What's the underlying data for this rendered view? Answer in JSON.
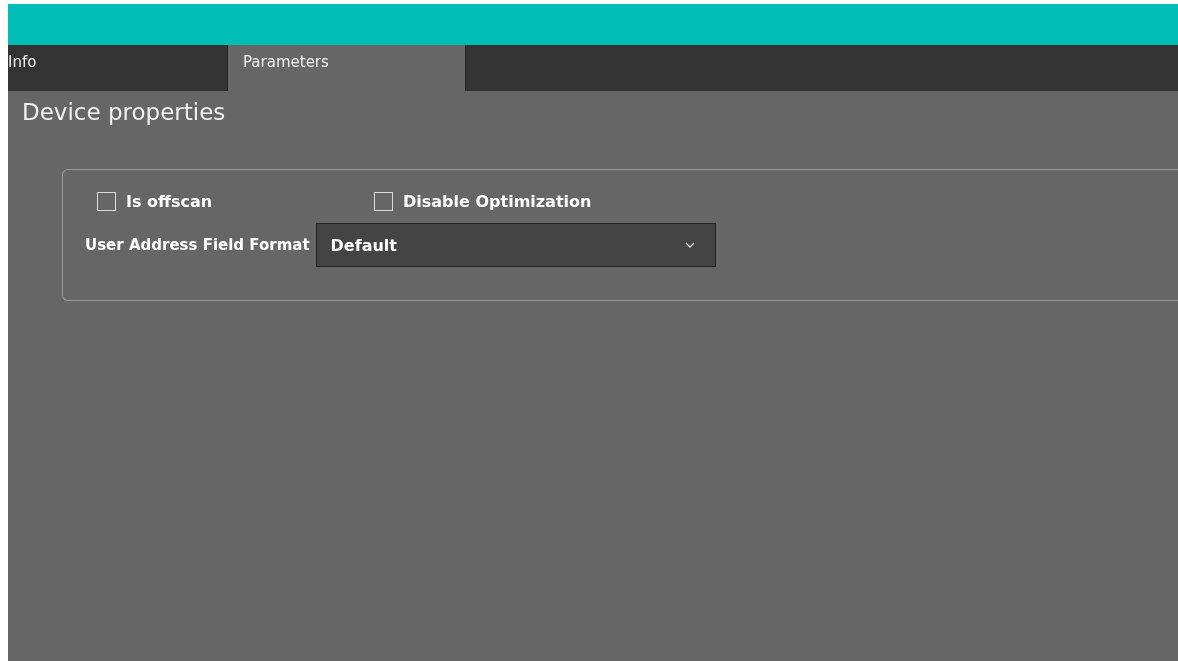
{
  "tabs": [
    {
      "label": "Info",
      "selected": false
    },
    {
      "label": "Parameters",
      "selected": true
    }
  ],
  "section_title": "Device properties",
  "options": [
    {
      "label": "Is offscan",
      "checked": false
    },
    {
      "label": "Disable Optimization",
      "checked": false
    }
  ],
  "address_format": {
    "label": "User Address Field Format",
    "value": "Default"
  }
}
